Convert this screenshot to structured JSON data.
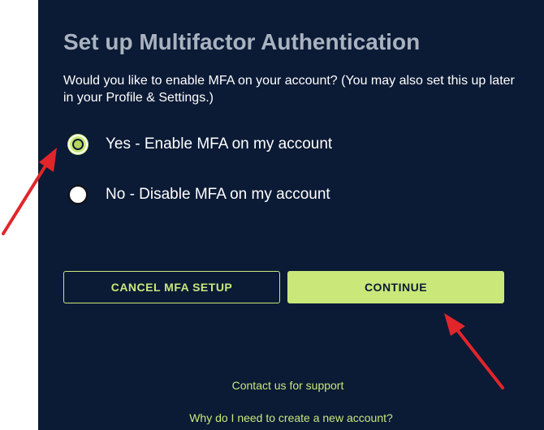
{
  "mfa": {
    "title": "Set up Multifactor Authentication",
    "description": "Would you like to enable MFA on your account? (You may also set this up later in your Profile & Settings.)",
    "options": [
      {
        "label": "Yes - Enable MFA on my account",
        "selected": true
      },
      {
        "label": "No - Disable MFA on my account",
        "selected": false
      }
    ],
    "buttons": {
      "cancel_label": "CANCEL MFA SETUP",
      "continue_label": "CONTINUE"
    },
    "links": {
      "support": "Contact us for support",
      "why_new_account": "Why do I need to create a new account?"
    }
  },
  "colors": {
    "panel_bg": "#0b1a35",
    "accent": "#c9e879",
    "title": "#a9b3bf",
    "annotation_arrow": "#e0262b"
  }
}
